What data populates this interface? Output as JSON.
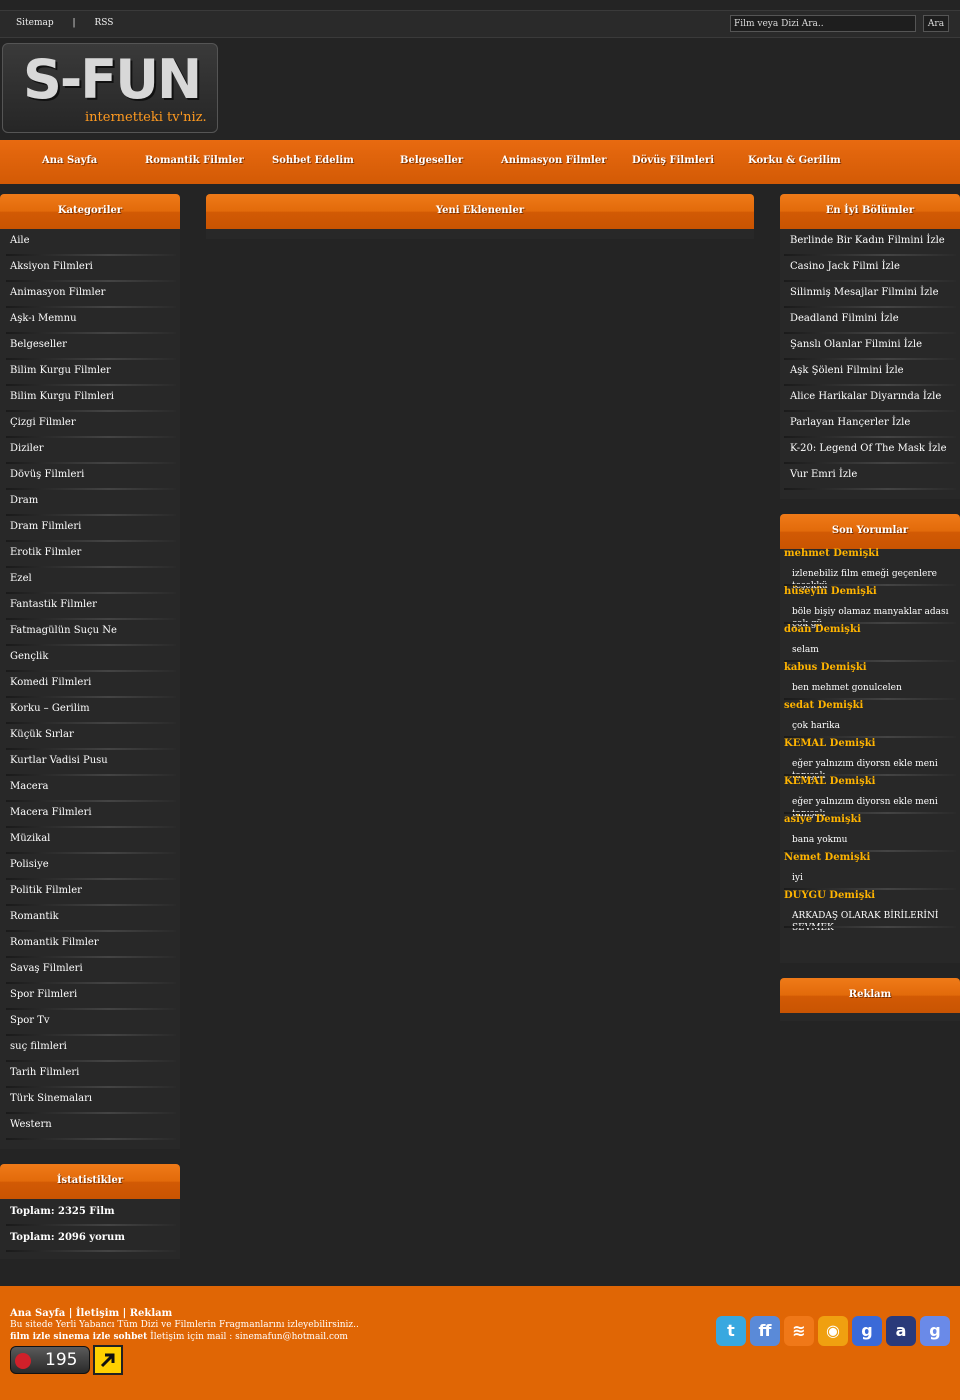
{
  "topbar": {
    "links": [
      "Sitemap",
      "|",
      "RSS"
    ],
    "search_placeholder": "Film veya Dizi Ara..",
    "search_button": "Ara"
  },
  "logo": {
    "title": "S-FUN",
    "tagline": "internetteki tv'niz."
  },
  "nav": [
    "Ana Sayfa",
    "Romantik Filmler",
    "Sohbet Edelim",
    "Belgeseller",
    "Animasyon Filmler",
    "Dövüş Filmleri",
    "Korku & Gerilim"
  ],
  "categories": {
    "title": "Kategoriler",
    "items": [
      "Aile",
      "Aksiyon Filmleri",
      "Animasyon Filmler",
      "Aşk-ı Memnu",
      "Belgeseller",
      "Bilim Kurgu Filmler",
      "Bilim Kurgu Filmleri",
      "Çizgi Filmler",
      "Diziler",
      "Dövüş Filmleri",
      "Dram",
      "Dram Filmleri",
      "Erotik Filmler",
      "Ezel",
      "Fantastik Filmler",
      "Fatmagülün Suçu Ne",
      "Gençlik",
      "Komedi Filmleri",
      "Korku – Gerilim",
      "Küçük Sırlar",
      "Kurtlar Vadisi Pusu",
      "Macera",
      "Macera Filmleri",
      "Müzikal",
      "Polisiye",
      "Politik Filmler",
      "Romantik",
      "Romantik Filmler",
      "Savaş Filmleri",
      "Spor Filmleri",
      "Spor Tv",
      "suç filmleri",
      "Tarih Filmleri",
      "Türk Sinemaları",
      "Western"
    ]
  },
  "stats": {
    "title": "İstatistikler",
    "items": [
      "Toplam: 2325 Film",
      "Toplam: 2096 yorum"
    ]
  },
  "main": {
    "title": "Yeni Eklenenler"
  },
  "best": {
    "title": "En İyi Bölümler",
    "items": [
      "Berlinde Bir Kadın Filmini İzle",
      "Casino Jack Filmi İzle",
      "Silinmiş Mesajlar Filmini İzle",
      "Deadland Filmini İzle",
      "Şanslı Olanlar Filmini İzle",
      "Aşk Şöleni Filmini İzle",
      "Alice Harikalar Diyarında İzle",
      "Parlayan Hançerler İzle",
      "K-20: Legend Of The Mask İzle",
      "Vur Emri İzle"
    ]
  },
  "comments": {
    "title": "Son Yorumlar",
    "items": [
      {
        "author": "mehmet Demişki",
        "text": "izlenebiliz film emeği geçenlere teşekkü"
      },
      {
        "author": "hüseyin Demişki",
        "text": "böle bişiy olamaz manyaklar adası çok gü"
      },
      {
        "author": "doan Demişki",
        "text": "selam"
      },
      {
        "author": "kabus Demişki",
        "text": "ben mehmet gonulcelen"
      },
      {
        "author": "sedat Demişki",
        "text": "çok harika"
      },
      {
        "author": "KEMAL Demişki",
        "text": "eğer yalnızım diyorsn ekle meni tanışalı"
      },
      {
        "author": "KEMAL Demişki",
        "text": "eğer yalnızım diyorsn ekle meni tanışalı"
      },
      {
        "author": "asiye Demişki",
        "text": "bana yokmu"
      },
      {
        "author": "Nemet Demişki",
        "text": "iyi"
      },
      {
        "author": "DUYGU Demişki",
        "text": "ARKADAŞ OLARAK BİRİLERİNİ SEVMEK"
      }
    ]
  },
  "ad": {
    "title": "Reklam"
  },
  "footer": {
    "links": "Ana Sayfa | İletişim | Reklam",
    "line1": "Bu sitede Yerli Yabancı Tüm Dizi ve Filmlerin Fragmanlarını izleyebilirsiniz..",
    "line2_bold": "film izle sinema izle sohbet",
    "line2": " İletişim için mail : sinemafun@hotmail.com",
    "counter": "195"
  },
  "social": [
    {
      "icon": "twitter-icon",
      "color": "#38a8e0",
      "glyph": "t"
    },
    {
      "icon": "friendfeed-icon",
      "color": "#5a8ad8",
      "glyph": "ff"
    },
    {
      "icon": "rss-icon",
      "color": "#f07818",
      "glyph": "≋"
    },
    {
      "icon": "technorati-icon",
      "color": "#f0a010",
      "glyph": "◉"
    },
    {
      "icon": "google-icon",
      "color": "#3a6ad8",
      "glyph": "g"
    },
    {
      "icon": "amazon-icon",
      "color": "#2a3a7a",
      "glyph": "a"
    },
    {
      "icon": "google-bookmarks-icon",
      "color": "#6a8ae8",
      "glyph": "g"
    }
  ]
}
